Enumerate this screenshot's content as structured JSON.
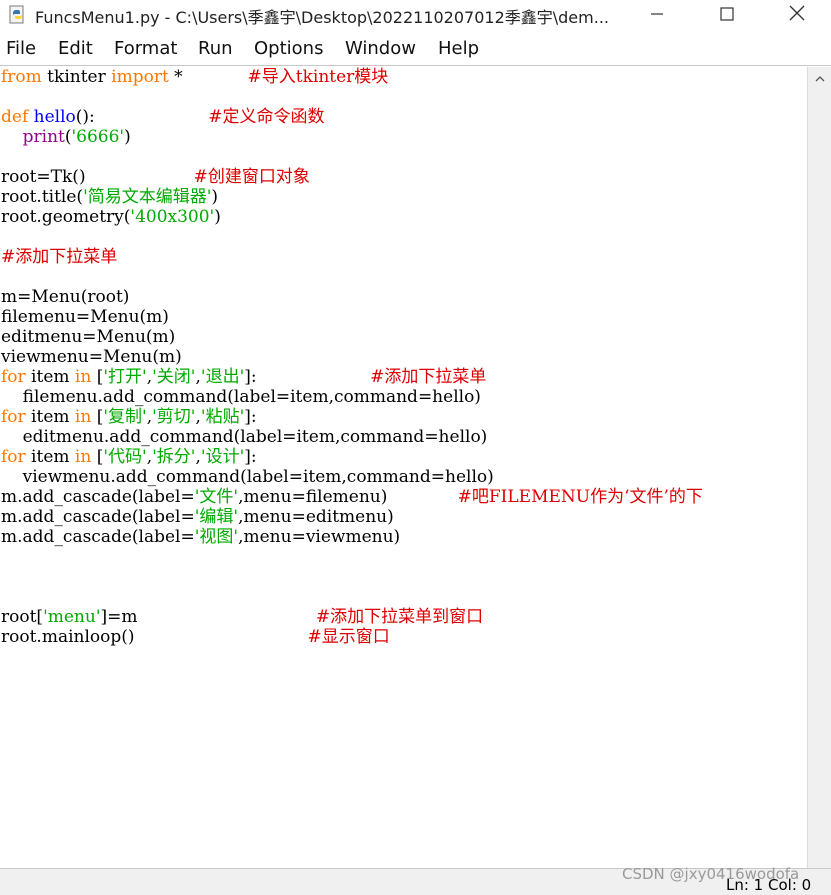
{
  "window": {
    "title": "FuncsMenu1.py - C:\\Users\\季鑫宇\\Desktop\\202211020701​2季鑫宇\\dem...",
    "app_icon": "python-idle-icon",
    "controls": [
      "minimize-icon",
      "maximize-icon",
      "close-icon"
    ]
  },
  "menubar": {
    "items": [
      "File",
      "Edit",
      "Format",
      "Run",
      "Options",
      "Window",
      "Help"
    ]
  },
  "code": {
    "lines": [
      [
        {
          "t": "from",
          "c": "kw"
        },
        {
          "t": " tkinter "
        },
        {
          "t": "import",
          "c": "kw"
        },
        {
          "t": " *            "
        },
        {
          "t": "#导入tkinter模块",
          "c": "cm"
        }
      ],
      [],
      [
        {
          "t": "def",
          "c": "kw"
        },
        {
          "t": " "
        },
        {
          "t": "hello",
          "c": "def"
        },
        {
          "t": "():                     "
        },
        {
          "t": "#定义命令函数",
          "c": "cm"
        }
      ],
      [
        {
          "t": "    "
        },
        {
          "t": "print",
          "c": "bi"
        },
        {
          "t": "("
        },
        {
          "t": "'6666'",
          "c": "str"
        },
        {
          "t": ")"
        }
      ],
      [],
      [
        {
          "t": "root=Tk()                    "
        },
        {
          "t": "#创建窗口对象",
          "c": "cm"
        }
      ],
      [
        {
          "t": "root.title("
        },
        {
          "t": "'简易文本编辑器'",
          "c": "str"
        },
        {
          "t": ")"
        }
      ],
      [
        {
          "t": "root.geometry("
        },
        {
          "t": "'400x300'",
          "c": "str"
        },
        {
          "t": ")"
        }
      ],
      [],
      [
        {
          "t": "#添加下拉菜单",
          "c": "cm"
        }
      ],
      [],
      [
        {
          "t": "m=Menu(root)"
        }
      ],
      [
        {
          "t": "filemenu=Menu(m)"
        }
      ],
      [
        {
          "t": "editmenu=Menu(m)"
        }
      ],
      [
        {
          "t": "viewmenu=Menu(m)"
        }
      ],
      [
        {
          "t": "for",
          "c": "kw"
        },
        {
          "t": " item "
        },
        {
          "t": "in",
          "c": "kw"
        },
        {
          "t": " ["
        },
        {
          "t": "'打开'",
          "c": "str"
        },
        {
          "t": ","
        },
        {
          "t": "'关闭'",
          "c": "str"
        },
        {
          "t": ","
        },
        {
          "t": "'退出'",
          "c": "str"
        },
        {
          "t": "]:                     "
        },
        {
          "t": "#添加下拉菜单",
          "c": "cm"
        }
      ],
      [
        {
          "t": "    filemenu.add_command(label=item,command=hello)"
        }
      ],
      [
        {
          "t": "for",
          "c": "kw"
        },
        {
          "t": " item "
        },
        {
          "t": "in",
          "c": "kw"
        },
        {
          "t": " ["
        },
        {
          "t": "'复制'",
          "c": "str"
        },
        {
          "t": ","
        },
        {
          "t": "'剪切'",
          "c": "str"
        },
        {
          "t": ","
        },
        {
          "t": "'粘贴'",
          "c": "str"
        },
        {
          "t": "]:"
        }
      ],
      [
        {
          "t": "    editmenu.add_command(label=item,command=hello)"
        }
      ],
      [
        {
          "t": "for",
          "c": "kw"
        },
        {
          "t": " item "
        },
        {
          "t": "in",
          "c": "kw"
        },
        {
          "t": " ["
        },
        {
          "t": "'代码'",
          "c": "str"
        },
        {
          "t": ","
        },
        {
          "t": "'拆分'",
          "c": "str"
        },
        {
          "t": ","
        },
        {
          "t": "'设计'",
          "c": "str"
        },
        {
          "t": "]:"
        }
      ],
      [
        {
          "t": "    viewmenu.add_command(label=item,command=hello)"
        }
      ],
      [
        {
          "t": "m.add_cascade(label="
        },
        {
          "t": "'文件'",
          "c": "str"
        },
        {
          "t": ",menu=filemenu)             "
        },
        {
          "t": "#吧FILEMENU作为‘文件’的下",
          "c": "cm"
        }
      ],
      [
        {
          "t": "m.add_cascade(label="
        },
        {
          "t": "'编辑'",
          "c": "str"
        },
        {
          "t": ",menu=editmenu)"
        }
      ],
      [
        {
          "t": "m.add_cascade(label="
        },
        {
          "t": "'视图'",
          "c": "str"
        },
        {
          "t": ",menu=viewmenu)"
        }
      ],
      [],
      [],
      [],
      [
        {
          "t": "root["
        },
        {
          "t": "'menu'",
          "c": "str"
        },
        {
          "t": "]=m                                 "
        },
        {
          "t": "#添加下拉菜单到窗口",
          "c": "cm"
        }
      ],
      [
        {
          "t": "root.mainloop()                                "
        },
        {
          "t": "#显示窗口",
          "c": "cm"
        }
      ]
    ]
  },
  "statusbar": {
    "position": "Ln: 1  Col: 0"
  },
  "watermark": "CSDN @jxy0416wodofa",
  "colors": {
    "keyword": "#ff7700",
    "definition": "#0000ff",
    "builtin": "#900090",
    "string": "#00aa00",
    "comment": "#dd0000"
  }
}
